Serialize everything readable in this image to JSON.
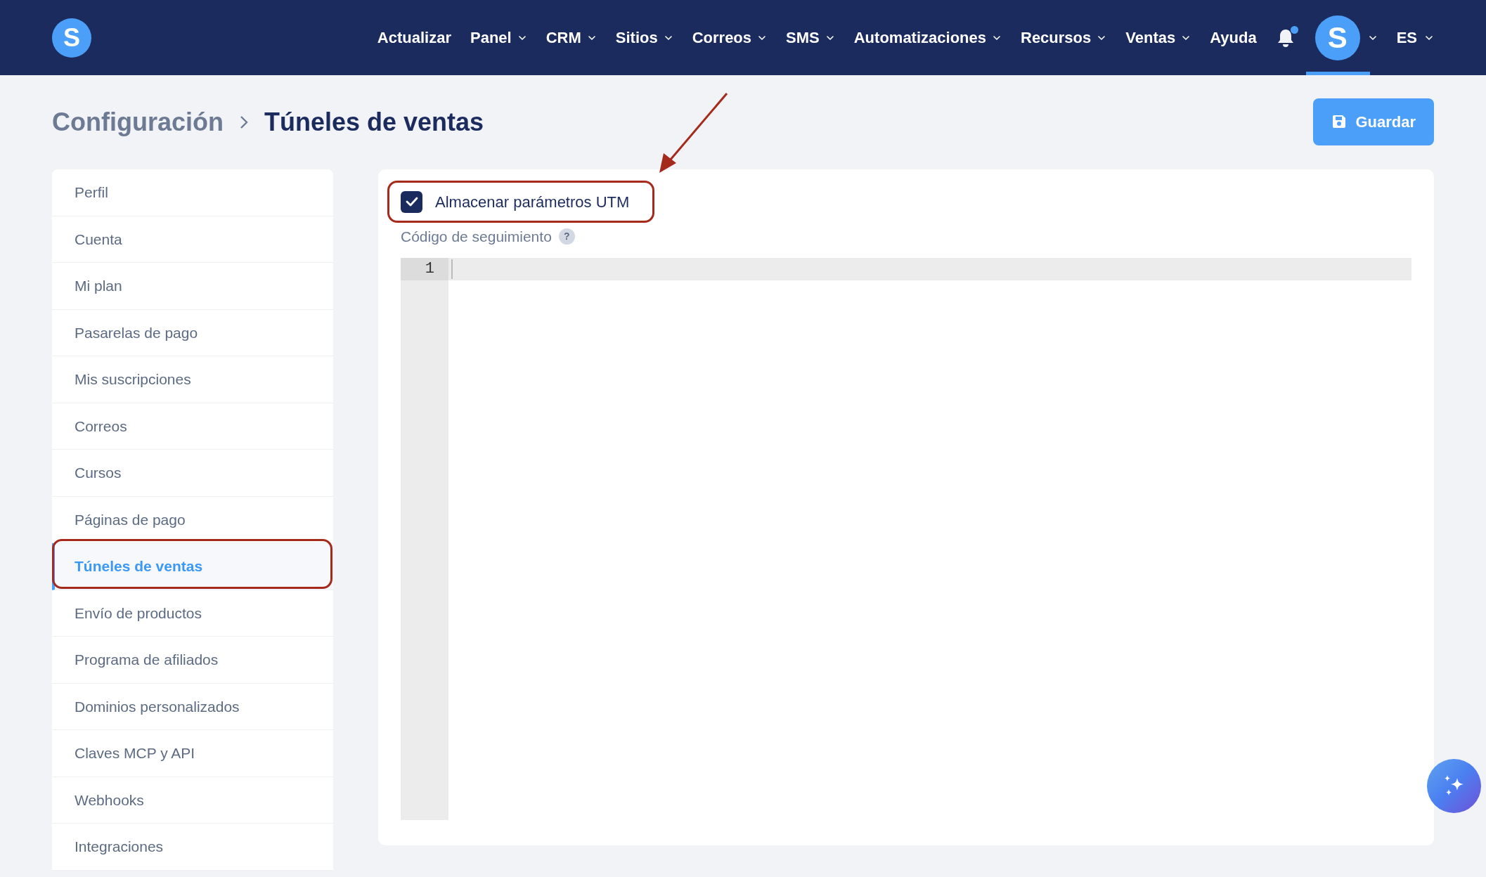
{
  "header": {
    "logo_letter": "S",
    "nav": [
      {
        "label": "Actualizar",
        "dropdown": false
      },
      {
        "label": "Panel",
        "dropdown": true
      },
      {
        "label": "CRM",
        "dropdown": true
      },
      {
        "label": "Sitios",
        "dropdown": true
      },
      {
        "label": "Correos",
        "dropdown": true
      },
      {
        "label": "SMS",
        "dropdown": true
      },
      {
        "label": "Automatizaciones",
        "dropdown": true
      },
      {
        "label": "Recursos",
        "dropdown": true
      },
      {
        "label": "Ventas",
        "dropdown": true
      },
      {
        "label": "Ayuda",
        "dropdown": false
      }
    ],
    "notification_unread": true,
    "avatar_letter": "S",
    "avatar_selected": true,
    "language": "ES"
  },
  "breadcrumb": [
    "Configuración",
    "Túneles de ventas"
  ],
  "save_button": "Guardar",
  "sidebar": {
    "items": [
      {
        "label": "Perfil",
        "selected": false
      },
      {
        "label": "Cuenta",
        "selected": false
      },
      {
        "label": "Mi plan",
        "selected": false
      },
      {
        "label": "Pasarelas de pago",
        "selected": false
      },
      {
        "label": "Mis suscripciones",
        "selected": false
      },
      {
        "label": "Correos",
        "selected": false
      },
      {
        "label": "Cursos",
        "selected": false
      },
      {
        "label": "Páginas de pago",
        "selected": false
      },
      {
        "label": "Túneles de ventas",
        "selected": true
      },
      {
        "label": "Envío de productos",
        "selected": false
      },
      {
        "label": "Programa de afiliados",
        "selected": false
      },
      {
        "label": "Dominios personalizados",
        "selected": false
      },
      {
        "label": "Claves MCP y API",
        "selected": false
      },
      {
        "label": "Webhooks",
        "selected": false
      },
      {
        "label": "Integraciones",
        "selected": false
      }
    ]
  },
  "settings": {
    "store_utm": {
      "label": "Almacenar parámetros UTM",
      "checked": true
    },
    "tracking_code": {
      "label": "Código de seguimiento",
      "help": "?",
      "line_numbers": [
        "1"
      ]
    }
  }
}
